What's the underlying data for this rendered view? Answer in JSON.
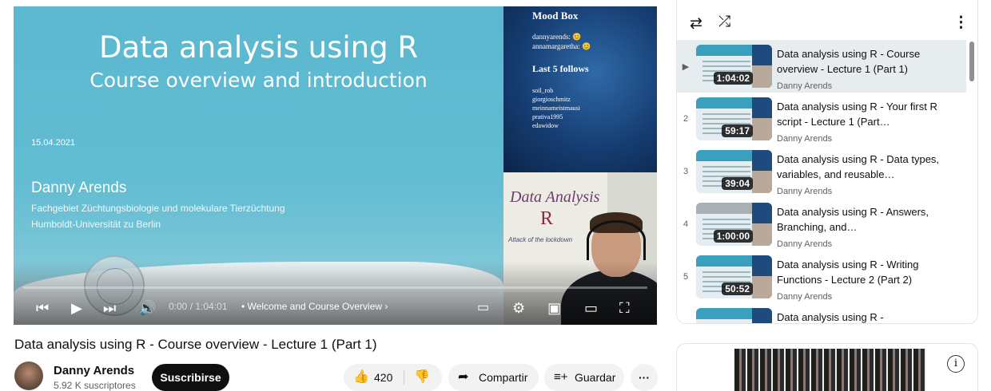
{
  "slide": {
    "title": "Data analysis using R",
    "subtitle": "Course overview and introduction",
    "date": "15.04.2021",
    "author": "Danny Arends",
    "affiliation_1": "Fachgebiet Züchtungsbiologie und molekulare Tierzüchtung",
    "affiliation_2": "Humboldt-Universität zu Berlin"
  },
  "mood_box": {
    "title": "Mood Box",
    "users": [
      "dannyarends: 😊",
      "annamargaretha: 😊"
    ],
    "follows_title": "Last 5 follows",
    "follows": [
      "soil_rob",
      "giorgioschmitz",
      "meinnameistmausi",
      "prativa1995",
      "edawidow"
    ]
  },
  "webcam": {
    "board_line1": "Data Analysis",
    "board_line2": "R",
    "board_line3": "Attack of the lockdown"
  },
  "player": {
    "time": "0:00 / 1:04:01",
    "chapter": "• Welcome and Course Overview ›",
    "icons": {
      "prev": "skip-previous-icon",
      "play": "play-icon",
      "next": "skip-next-icon",
      "volume": "volume-icon",
      "subtitles": "subtitles-icon",
      "settings": "gear-icon",
      "miniplayer": "miniplayer-icon",
      "theater": "theater-icon",
      "fullscreen": "fullscreen-icon"
    }
  },
  "video": {
    "title": "Data analysis using R - Course overview - Lecture 1 (Part 1)",
    "channel": "Danny Arends",
    "subscribers": "5.92 K suscriptores",
    "subscribe_label": "Suscribirse",
    "likes": "420",
    "share_label": "Compartir",
    "save_label": "Guardar",
    "more_label": "···"
  },
  "playlist": {
    "loop_icon": "⇄",
    "shuffle_icon": "⤮",
    "menu_icon": "⋮",
    "items": [
      {
        "index": "▶",
        "title": "Data analysis using R - Course overview - Lecture 1 (Part 1)",
        "author": "Danny Arends",
        "duration": "1:04:02",
        "active": true
      },
      {
        "index": "2",
        "title": "Data analysis using R - Your first R script - Lecture 1 (Part…",
        "author": "Danny Arends",
        "duration": "59:17"
      },
      {
        "index": "3",
        "title": "Data analysis using R - Data types, variables, and reusable…",
        "author": "Danny Arends",
        "duration": "39:04"
      },
      {
        "index": "4",
        "title": "Data analysis using R - Answers, Branching, and…",
        "author": "Danny Arends",
        "duration": "1:00:00"
      },
      {
        "index": "5",
        "title": "Data analysis using R - Writing Functions - Lecture 2 (Part 2)",
        "author": "Danny Arends",
        "duration": "50:52"
      },
      {
        "index": "",
        "title": "Data analysis using R -",
        "author": "",
        "duration": ""
      }
    ]
  },
  "ad": {
    "info_icon": "i"
  }
}
